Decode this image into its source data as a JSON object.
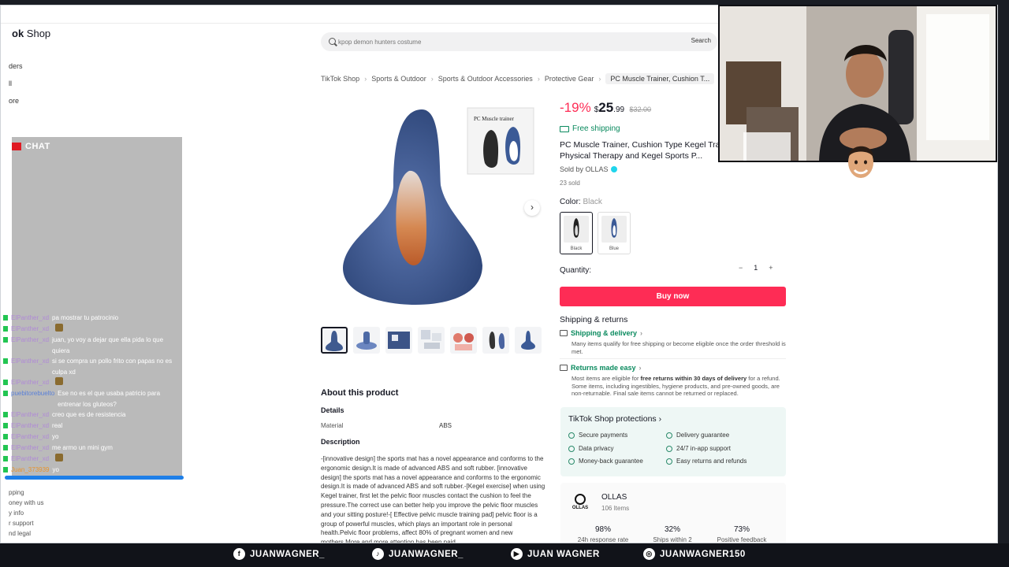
{
  "shop": {
    "logo_left": "ok",
    "logo_right": "Shop"
  },
  "left_nav": [
    "ders",
    "ll",
    "ore"
  ],
  "left_footer": [
    "pping",
    "oney with us",
    "y info",
    "r support",
    "nd legal"
  ],
  "search": {
    "placeholder": "kpop demon hunters costume",
    "button": "Search"
  },
  "breadcrumb": [
    "TikTok Shop",
    "Sports & Outdoor",
    "Sports & Outdoor Accessories",
    "Protective Gear",
    "PC Muscle Trainer, Cushion T..."
  ],
  "product": {
    "discount": "-19%",
    "currency": "$",
    "price_whole": "25",
    "price_cents": ".99",
    "old_price": "$32.00",
    "free_shipping": "Free shipping",
    "title": "PC Muscle Trainer, Cushion Type Kegel Trainer, Pelvic Floor Physical Therapy and Kegel Sports P...",
    "sold_by": "Sold by OLLAS",
    "sold_count": "23 sold",
    "color_label": "Color:",
    "color_value": "Black",
    "swatches": [
      "Black",
      "Blue"
    ],
    "qty_label": "Quantity:",
    "qty_minus": "−",
    "qty_value": "1",
    "qty_plus": "+",
    "buy_now": "Buy now",
    "box_label": "PC Muscle trainer"
  },
  "shipping": {
    "heading": "Shipping & returns",
    "delivery_title": "Shipping & delivery",
    "delivery_text": "Many items qualify for free shipping or become eligible once the order threshold is met.",
    "returns_title": "Returns made easy",
    "returns_pre": "Most items are eligible for ",
    "returns_bold": "free returns within 30 days of delivery",
    "returns_post": " for a refund. Some items, including ingestibles, hygiene products, and pre-owned goods, are non-returnable. Final sale items cannot be returned or replaced."
  },
  "protections": {
    "heading": "TikTok Shop protections",
    "items": [
      "Secure payments",
      "Delivery guarantee",
      "Data privacy",
      "24/7 in-app support",
      "Money-back guarantee",
      "Easy returns and refunds"
    ]
  },
  "seller": {
    "logo_text": "OLLAS",
    "name": "OLLAS",
    "items": "106 Items",
    "stats": [
      {
        "value": "98%",
        "label": "24h response rate"
      },
      {
        "value": "32%",
        "label": "Ships within 2"
      },
      {
        "value": "73%",
        "label": "Positive feedback"
      }
    ]
  },
  "about": {
    "heading": "About this product",
    "details_heading": "Details",
    "material_key": "Material",
    "material_value": "ABS",
    "description_heading": "Description",
    "description": "-[innovative design] the sports mat has a novel appearance and conforms to the ergonomic design.It is made of advanced ABS and soft rubber. [innovative design] the sports mat has a novel appearance and conforms to the ergonomic design.It is made of advanced ABS and soft rubber.-[Kegel exercise] when using Kegel trainer, first let the pelvic floor muscles contact the cushion to feel the pressure.The correct use can better help you improve the pelvic floor muscles and your sitting posture!-[ Effective pelvic muscle training pad] pelvic floor is a group of powerful muscles, which plays an important role in personal health.Pelvic floor problems, affect 80% of pregnant women and new mothers.More and more attention has been paid"
  },
  "chat": {
    "title": "CHAT",
    "messages": [
      {
        "user": "ElPanther_xd",
        "text": "pa mostrar tu patrocinio",
        "color": "purple"
      },
      {
        "user": "ElPanther_xd",
        "text": "",
        "emote": true,
        "color": "purple"
      },
      {
        "user": "ElPanther_xd",
        "text": "juan, yo voy a dejar que ella pida lo que quiera",
        "color": "purple"
      },
      {
        "user": "ElPanther_xd",
        "text": "si se compra un pollo frito con papas no es culpa xd",
        "color": "purple"
      },
      {
        "user": "ElPanther_xd",
        "text": "",
        "emote": true,
        "color": "purple"
      },
      {
        "user": "puebitorebuelto",
        "text": "Ese no es el que usaba patricio para entrenar los gluteos?",
        "color": "blue"
      },
      {
        "user": "ElPanther_xd",
        "text": "creo que es de resistencia",
        "color": "purple"
      },
      {
        "user": "ElPanther_xd",
        "text": "real",
        "color": "purple"
      },
      {
        "user": "ElPanther_xd",
        "text": "yo",
        "color": "purple"
      },
      {
        "user": "ElPanther_xd",
        "text": "me armo un mini gym",
        "color": "purple"
      },
      {
        "user": "ElPanther_xd",
        "text": "",
        "emote": true,
        "color": "purple"
      },
      {
        "user": "Juan_373939",
        "text": "yo",
        "color": "orange"
      }
    ]
  },
  "socials": [
    {
      "icon": "facebook-icon",
      "glyph": "f",
      "handle": "JUANWAGNER_"
    },
    {
      "icon": "tiktok-icon",
      "glyph": "♪",
      "handle": "JUANWAGNER_"
    },
    {
      "icon": "youtube-icon",
      "glyph": "▶",
      "handle": "JUAN WAGNER"
    },
    {
      "icon": "instagram-icon",
      "glyph": "◎",
      "handle": "JUANWAGNER150"
    }
  ],
  "colors": {
    "accent": "#fe2c55",
    "shipping_green": "#0a8a5e",
    "chat_blue": "#1e7fe8",
    "product_blue": "#3f5a8f"
  }
}
